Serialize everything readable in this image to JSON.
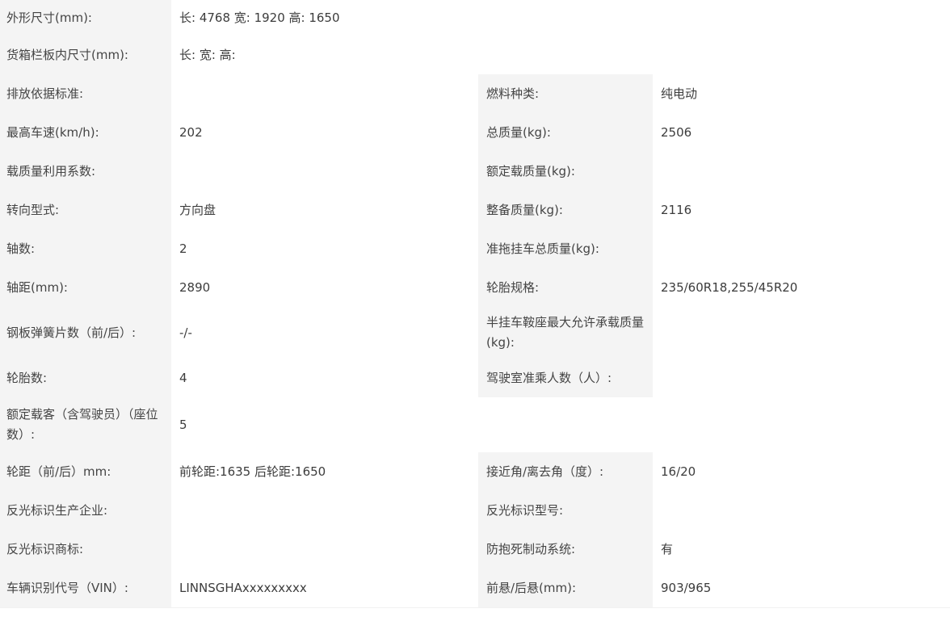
{
  "rows": [
    {
      "label": "外形尺寸(mm):",
      "value": "长: 4768 宽: 1920 高: 1650"
    },
    {
      "label": "货箱栏板内尺寸(mm):",
      "value": "长:   宽:   高:"
    },
    {
      "label": "排放依据标准:",
      "value": "",
      "label2": "燃料种类:",
      "value2": "纯电动"
    },
    {
      "label": "最高车速(km/h):",
      "value": "202",
      "label2": "总质量(kg):",
      "value2": "2506"
    },
    {
      "label": "载质量利用系数:",
      "value": "",
      "label2": "额定载质量(kg):",
      "value2": ""
    },
    {
      "label": "转向型式:",
      "value": "方向盘",
      "label2": "整备质量(kg):",
      "value2": "2116"
    },
    {
      "label": "轴数:",
      "value": "2",
      "label2": "准拖挂车总质量(kg):",
      "value2": ""
    },
    {
      "label": "轴距(mm):",
      "value": "2890",
      "label2": "轮胎规格:",
      "value2": "235/60R18,255/45R20"
    },
    {
      "label": "钢板弹簧片数（前/后）:",
      "value": "-/-",
      "label2": "半挂车鞍座最大允许承载质量(kg):",
      "value2": ""
    },
    {
      "label": "轮胎数:",
      "value": "4",
      "label2": "驾驶室准乘人数（人）:",
      "value2": ""
    },
    {
      "label": "额定载客（含驾驶员）（座位数）:",
      "value": "5"
    },
    {
      "label": "轮距（前/后）mm:",
      "value": "前轮距:1635 后轮距:1650",
      "label2": "接近角/离去角（度）:",
      "value2": "16/20"
    },
    {
      "label": "反光标识生产企业:",
      "value": "",
      "label2": "反光标识型号:",
      "value2": ""
    },
    {
      "label": "反光标识商标:",
      "value": "",
      "label2": "防抱死制动系统:",
      "value2": "有"
    },
    {
      "label": "车辆识别代号（VIN）:",
      "value": "LINNSGHAxxxxxxxxx",
      "label2": "前悬/后悬(mm):",
      "value2": "903/965"
    }
  ]
}
